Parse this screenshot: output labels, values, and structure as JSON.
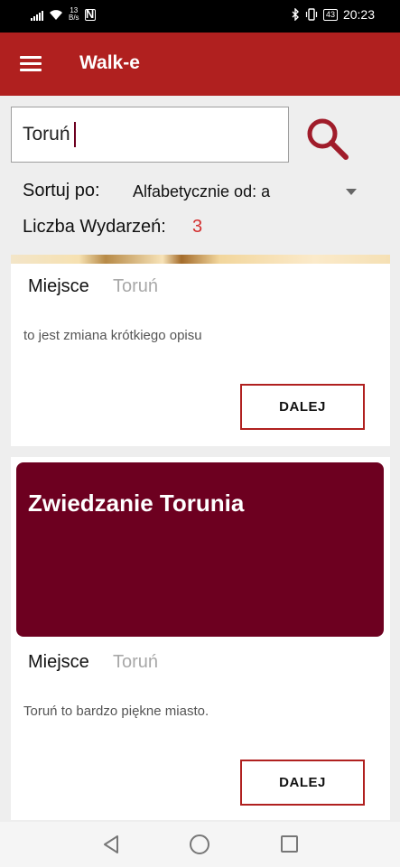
{
  "status_bar": {
    "net_speed_value": "13",
    "net_speed_unit": "B/s",
    "nfc_icon": "N",
    "battery": "43",
    "time": "20:23"
  },
  "app_bar": {
    "title": "Walk-e",
    "menu_icon": "hamburger-menu-icon"
  },
  "search": {
    "value": "Toruń",
    "icon": "search-icon"
  },
  "sort": {
    "label": "Sortuj po:",
    "selected": "Alfabetycznie od: a"
  },
  "events_count": {
    "label": "Liczba Wydarzeń:",
    "value": "3"
  },
  "events": [
    {
      "title": "",
      "place_label": "Miejsce",
      "place": "Toruń",
      "description": "to jest zmiana krótkiego opisu",
      "button": "DALEJ"
    },
    {
      "title": "Zwiedzanie Torunia",
      "place_label": "Miejsce",
      "place": "Toruń",
      "description": "Toruń to bardzo piękne miasto.",
      "button": "DALEJ"
    }
  ],
  "colors": {
    "app_bar": "#b0201f",
    "banner": "#6d0020",
    "accent": "#d32f2f"
  }
}
